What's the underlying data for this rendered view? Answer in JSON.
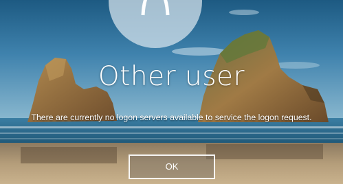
{
  "login": {
    "user_name": "Other user",
    "message": "There are currently no logon servers available to service the logon request.",
    "ok_label": "OK",
    "avatar_icon": "user-silhouette-icon"
  },
  "colors": {
    "button_border": "#ffffff",
    "text": "#ffffff",
    "sky_top": "#1f5e86",
    "sea": "#2f6f93",
    "sand": "#bda784"
  }
}
